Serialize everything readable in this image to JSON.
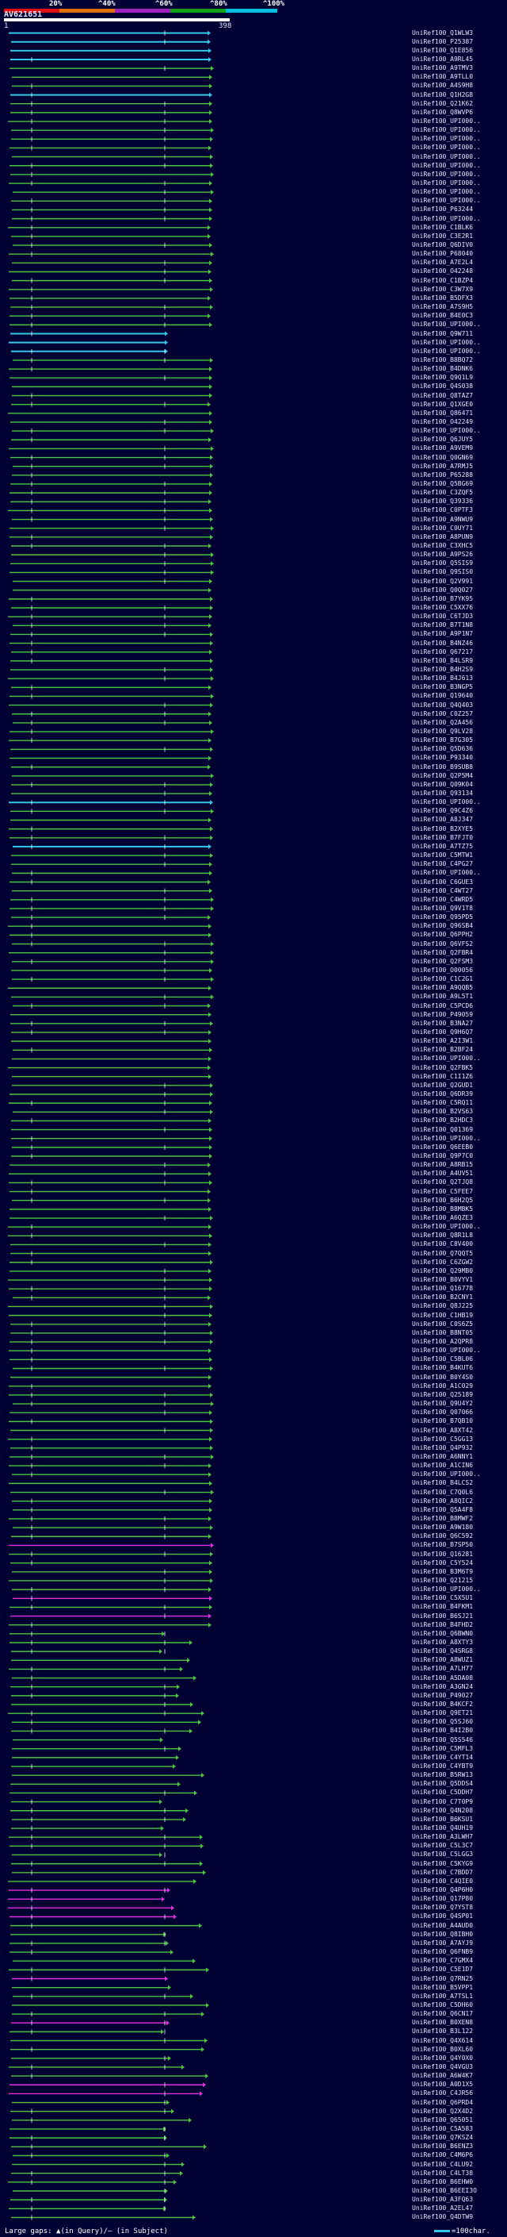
{
  "scale": {
    "labels": [
      "20%",
      "^40%",
      "^60%",
      "^80%",
      "^100%"
    ],
    "segment_colors": [
      "#e01010",
      "#e07000",
      "#a020c0",
      "#10a010",
      "#00c0e0"
    ]
  },
  "query": {
    "id": "AV621651",
    "start": "1",
    "end": "398"
  },
  "colors": {
    "background": "#000033",
    "identity_high": "#36c8e8",
    "identity_mid": "#4cc640",
    "identity_low": "#e030e0",
    "line": "#ffffff"
  },
  "footer": {
    "gaps_label": "Large gaps: ▲(in Query)/– (in Subject)",
    "scale_label": "=100char."
  },
  "hits": [
    "UniRef100_Q1WLW3",
    "UniRef100_P25387",
    "UniRef100_Q1E856",
    "UniRef100_A9RL45",
    "UniRef100_A9TMV3",
    "UniRef100_A9TLL0",
    "UniRef100_A4S9H8",
    "UniRef100_Q1H2G8",
    "UniRef100_Q21K62",
    "UniRef100_Q8WVP6",
    "UniRef100_UPI000..",
    "UniRef100_UPI000..",
    "UniRef100_UPI000..",
    "UniRef100_UPI000..",
    "UniRef100_UPI000..",
    "UniRef100_UPI000..",
    "UniRef100_UPI000..",
    "UniRef100_UPI000..",
    "UniRef100_UPI000..",
    "UniRef100_UPI000..",
    "UniRef100_P63244",
    "UniRef100_UPI000..",
    "UniRef100_C1BLK6",
    "UniRef100_C3E2R1",
    "UniRef100_Q6DIV0",
    "UniRef100_P68040",
    "UniRef100_A7E2L4",
    "UniRef100_O42248",
    "UniRef100_C1BZP4",
    "UniRef100_C3W7X9",
    "UniRef100_B5DFX3",
    "UniRef100_A7S9H5",
    "UniRef100_B4E0C3",
    "UniRef100_UPI000..",
    "UniRef100_Q9W711",
    "UniRef100_UPI000..",
    "UniRef100_UPI000..",
    "UniRef100_B8BQ72",
    "UniRef100_B4DNK6",
    "UniRef100_Q9Q1L9",
    "UniRef100_Q4S038",
    "UniRef100_Q8TAZ7",
    "UniRef100_Q1XGE0",
    "UniRef100_Q86471",
    "UniRef100_O42249",
    "UniRef100_UPI000..",
    "UniRef100_Q6JUY5",
    "UniRef100_A9VEM9",
    "UniRef100_Q0GN69",
    "UniRef100_A7RMJ5",
    "UniRef100_P65288",
    "UniRef100_Q5BG69",
    "UniRef100_C3ZQF5",
    "UniRef100_Q39336",
    "UniRef100_C0PTF3",
    "UniRef100_A9NWU9",
    "UniRef100_C0UY71",
    "UniRef100_A8PUN9",
    "UniRef100_C3XHC5",
    "UniRef100_A9PS26",
    "UniRef100_Q5SIS9",
    "UniRef100_Q9SIS0",
    "UniRef100_Q2V991",
    "UniRef100_Q0Q027",
    "UniRef100_B7YK95",
    "UniRef100_C5XX76",
    "UniRef100_C6TJD3",
    "UniRef100_B7T1N8",
    "UniRef100_A9P1N7",
    "UniRef100_B4NZ46",
    "UniRef100_Q67217",
    "UniRef100_B4LSR9",
    "UniRef100_B4H2S9",
    "UniRef100_B4J613",
    "UniRef100_B3NGP5",
    "UniRef100_Q19640",
    "UniRef100_Q4Q403",
    "UniRef100_C0Z257",
    "UniRef100_Q2A456",
    "UniRef100_Q9LV28",
    "UniRef100_B7G305",
    "UniRef100_Q5D636",
    "UniRef100_P93340",
    "UniRef100_B9SUB8",
    "UniRef100_Q2P5M4",
    "UniRef100_Q09K04",
    "UniRef100_Q93134",
    "UniRef100_UPI000..",
    "UniRef100_Q9C4Z6",
    "UniRef100_A8J347",
    "UniRef100_B2XYE5",
    "UniRef100_B7FJT0",
    "UniRef100_A7TZ75",
    "UniRef100_C5MTW1",
    "UniRef100_C4PG27",
    "UniRef100_UPI000..",
    "UniRef100_C6GUE3",
    "UniRef100_C4WT27",
    "UniRef100_C4WRD5",
    "UniRef100_Q9V1T8",
    "UniRef100_Q95PD5",
    "UniRef100_Q96SB4",
    "UniRef100_Q6PPH2",
    "UniRef100_Q6VFS2",
    "UniRef100_Q2FBR4",
    "UniRef100_Q2FSM3",
    "UniRef100_O00056",
    "UniRef100_C1C2G1",
    "UniRef100_A9QQB5",
    "UniRef100_A9L5T1",
    "UniRef100_C5PCD6",
    "UniRef100_P49059",
    "UniRef100_B3NA27",
    "UniRef100_Q9H6Q7",
    "UniRef100_A2I3W1",
    "UniRef100_B2BF24",
    "UniRef100_UPI000..",
    "UniRef100_Q2FBK5",
    "UniRef100_C1I1Z6",
    "UniRef100_Q2GUD1",
    "UniRef100_Q6DR39",
    "UniRef100_C5RQ11",
    "UniRef100_B2VS63",
    "UniRef100_B2HDC3",
    "UniRef100_Q01369",
    "UniRef100_UPI000..",
    "UniRef100_Q6EEB0",
    "UniRef100_Q9P7C0",
    "UniRef100_A8RB15",
    "UniRef100_A4UV51",
    "UniRef100_Q2TJQ8",
    "UniRef100_C5FEE7",
    "UniRef100_B6H2Q5",
    "UniRef100_B8MBK5",
    "UniRef100_A6QZE3",
    "UniRef100_UPI000..",
    "UniRef100_Q8R1L8",
    "UniRef100_C8V400",
    "UniRef100_Q7QQT5",
    "UniRef100_C6ZGW2",
    "UniRef100_Q29MB0",
    "UniRef100_B0VYV1",
    "UniRef100_Q16778",
    "UniRef100_B2CNY1",
    "UniRef100_Q8J225",
    "UniRef100_C1HB19",
    "UniRef100_C0S6Z5",
    "UniRef100_B8NT05",
    "UniRef100_A2QPR8",
    "UniRef100_UPI000..",
    "UniRef100_C5BL06",
    "UniRef100_B4KUT6",
    "UniRef100_B0Y4S0",
    "UniRef100_A1C029",
    "UniRef100_Q25189",
    "UniRef100_Q9U4Y2",
    "UniRef100_Q07066",
    "UniRef100_B7QB10",
    "UniRef100_A8XT42",
    "UniRef100_C5GG13",
    "UniRef100_Q4P932",
    "UniRef100_A6NNY1",
    "UniRef100_A1CIN6",
    "UniRef100_UPI000..",
    "UniRef100_B4LCS2",
    "UniRef100_C7Q0L6",
    "UniRef100_A8QIC2",
    "UniRef100_Q5A4F8",
    "UniRef100_B8MWF2",
    "UniRef100_A9W180",
    "UniRef100_Q6C592",
    "UniRef100_B7SP50",
    "UniRef100_Q16281",
    "UniRef100_C5Y524",
    "UniRef100_B3M6T9",
    "UniRef100_Q21215",
    "UniRef100_UPI000..",
    "UniRef100_C5X5U1",
    "UniRef100_B4FKM1",
    "UniRef100_B6SJ21",
    "UniRef100_B4FHD2",
    "UniRef100_Q6BWN0",
    "UniRef100_A8XTY3",
    "UniRef100_Q4SRG8",
    "UniRef100_A8WUZ1",
    "UniRef100_A7LH77",
    "UniRef100_A5DA08",
    "UniRef100_A3GN24",
    "UniRef100_P49027",
    "UniRef100_B4KCF2",
    "UniRef100_Q9ET21",
    "UniRef100_Q5SJ60",
    "UniRef100_B4I2B0",
    "UniRef100_Q5S546",
    "UniRef100_C5MFL3",
    "UniRef100_C4YT14",
    "UniRef100_C4YBT9",
    "UniRef100_B5RW13",
    "UniRef100_Q5DDS4",
    "UniRef100_C5DDH7",
    "UniRef100_C7T0P9",
    "UniRef100_Q4N208",
    "UniRef100_B6KSU1",
    "UniRef100_Q4UH19",
    "UniRef100_A3LWH7",
    "UniRef100_C5L3C7",
    "UniRef100_C5LGG3",
    "UniRef100_C5KYG9",
    "UniRef100_C7BDD7",
    "UniRef100_C4QIE0",
    "UniRef100_Q4P6H0",
    "UniRef100_Q17P80",
    "UniRef100_Q7YST8",
    "UniRef100_Q4SP01",
    "UniRef100_A4AUD0",
    "UniRef100_Q8IBH0",
    "UniRef100_A7AYJ9",
    "UniRef100_Q6FNB9",
    "UniRef100_C7GMX4",
    "UniRef100_C5E1D7",
    "UniRef100_Q7RN25",
    "UniRef100_B5VPP1",
    "UniRef100_A7TSL1",
    "UniRef100_C5DH60",
    "UniRef100_Q6CN17",
    "UniRef100_B0XEN8",
    "UniRef100_B3L122",
    "UniRef100_Q4X614",
    "UniRef100_B0XL60",
    "UniRef100_Q4Y0X0",
    "UniRef100_Q4VGU3",
    "UniRef100_A6W4K7",
    "UniRef100_A0D1X5",
    "UniRef100_C4JR56",
    "UniRef100_Q6PRD4",
    "UniRef100_Q2X4D2",
    "UniRef100_Q65051",
    "UniRef100_C5A583",
    "UniRef100_Q7KSZ4",
    "UniRef100_B6ENZ3",
    "UniRef100_C4M6P6",
    "UniRef100_C4LU92",
    "UniRef100_C4LT38",
    "UniRef100_B6EHW0",
    "UniRef100_B6EEI3O",
    "UniRef100_A3FQ63",
    "UniRef100_A2EL47",
    "UniRef100_Q4DTW9"
  ]
}
